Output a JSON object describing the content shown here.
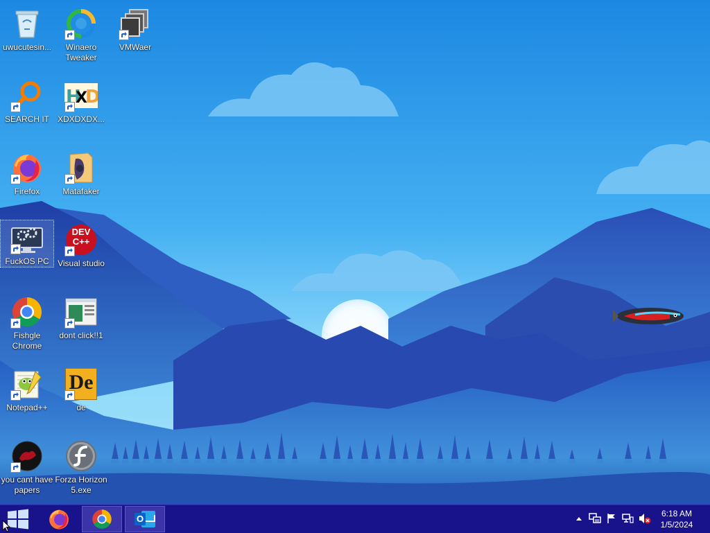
{
  "desktop": {
    "icons": [
      {
        "label": "uwucutesin...",
        "icon": "recycle-bin-icon"
      },
      {
        "label": "Winaero Tweaker",
        "icon": "winaero-icon"
      },
      {
        "label": "VMWaer",
        "icon": "vmware-icon"
      },
      {
        "label": "SEARCH IT",
        "icon": "magnifier-icon"
      },
      {
        "label": "XDXDXDX...",
        "icon": "hxd-icon"
      },
      {
        "label": "Firefox",
        "icon": "firefox-icon"
      },
      {
        "label": "Matafaker",
        "icon": "folder-icon"
      },
      {
        "label": "FuckOS PC",
        "icon": "computer-icon"
      },
      {
        "label": "Visual studio",
        "icon": "devcpp-icon"
      },
      {
        "label": "Fishgle Chrome",
        "icon": "chrome-icon"
      },
      {
        "label": "dont click!!1",
        "icon": "window-app-icon"
      },
      {
        "label": "Notepad++",
        "icon": "notepadpp-icon"
      },
      {
        "label": "de",
        "icon": "de-icon"
      },
      {
        "label": "you cant have papers",
        "icon": "dark-logo-icon"
      },
      {
        "label": "Forza Horizon 5.exe",
        "icon": "flash-icon"
      }
    ],
    "dev_text": "DEV C++",
    "de_text": "De"
  },
  "taskbar": {
    "pinned": [
      {
        "name": "firefox",
        "icon": "firefox-icon"
      },
      {
        "name": "chrome",
        "icon": "chrome-icon"
      },
      {
        "name": "outlook",
        "icon": "outlook-icon"
      }
    ],
    "outlook_letter": "O",
    "clock": {
      "time": "6:18 AM",
      "date": "1/5/2024"
    },
    "tray": [
      "chevron-up-icon",
      "network-display-icon",
      "flag-icon",
      "network-icon",
      "volume-muted-icon"
    ]
  },
  "colors": {
    "taskbar": "#19138b",
    "taskbar_active": "#3b34a8"
  }
}
